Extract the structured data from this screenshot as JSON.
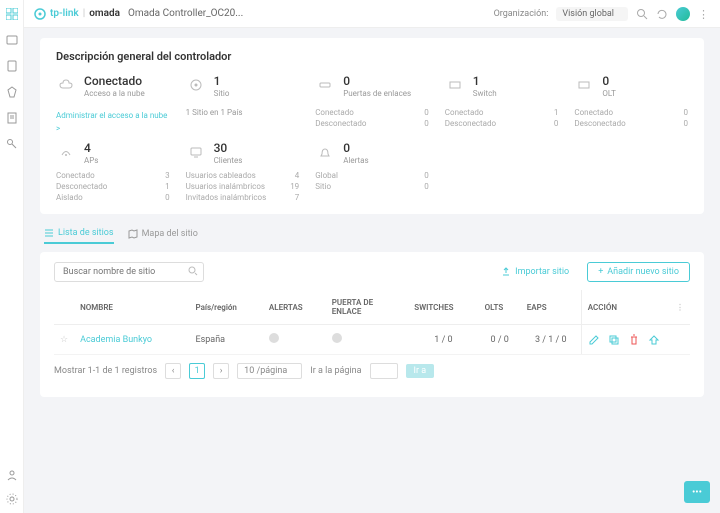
{
  "brand": {
    "tp": "tp-link",
    "omada": "omada"
  },
  "breadcrumb": "Omada Controller_OC20...",
  "org_label": "Organización:",
  "org_value": "Visión global",
  "card_title": "Descripción general del controlador",
  "stats": {
    "connection": {
      "value": "Conectado",
      "label": "Acceso a la nube",
      "link": "Administrar el acceso a la nube >"
    },
    "sites": {
      "value": "1",
      "label": "Sitio",
      "note": "1 Sitio en 1 País"
    },
    "gateways": {
      "value": "0",
      "label": "Puertas de enlaces",
      "connected_l": "Conectado",
      "connected_v": "0",
      "disconnected_l": "Desconectado",
      "disconnected_v": "0"
    },
    "switches": {
      "value": "1",
      "label": "Switch",
      "connected_l": "Conectado",
      "connected_v": "1",
      "disconnected_l": "Desconectado",
      "disconnected_v": "0"
    },
    "olts": {
      "value": "0",
      "label": "OLT",
      "connected_l": "Conectado",
      "connected_v": "0",
      "disconnected_l": "Desconectado",
      "disconnected_v": "0"
    },
    "aps": {
      "value": "4",
      "label": "APs",
      "r1l": "Conectado",
      "r1v": "3",
      "r2l": "Desconectado",
      "r2v": "1",
      "r3l": "Aislado",
      "r3v": "0"
    },
    "clients": {
      "value": "30",
      "label": "Clientes",
      "r1l": "Usuarios cableados",
      "r1v": "4",
      "r2l": "Usuarios inalámbricos",
      "r2v": "19",
      "r3l": "Invitados inalámbricos",
      "r3v": "7"
    },
    "alerts": {
      "value": "0",
      "label": "Alertas",
      "r1l": "Global",
      "r1v": "0",
      "r2l": "Sitio",
      "r2v": "0"
    }
  },
  "tabs": {
    "list": "Lista de sitios",
    "map": "Mapa del sitio"
  },
  "search_placeholder": "Buscar nombre de sitio",
  "import_btn": "Importar sitio",
  "add_btn": "Añadir nuevo sitio",
  "cols": {
    "name": "NOMBRE",
    "country": "País/región",
    "alerts": "ALERTAS",
    "gateway": "PUERTA DE ENLACE",
    "switches": "SWITCHES",
    "olts": "OLTS",
    "eaps": "EAPS",
    "action": "ACCIÓN"
  },
  "row": {
    "name": "Academia Bunkyo",
    "country": "España",
    "switches": "1 / 0",
    "olts": "0 / 0",
    "eaps": "3 / 1 / 0"
  },
  "pager": {
    "showing": "Mostrar 1-1 de 1 registros",
    "page": "1",
    "per": "10 /página",
    "goto": "Ir a la página",
    "go": "Ir a"
  }
}
